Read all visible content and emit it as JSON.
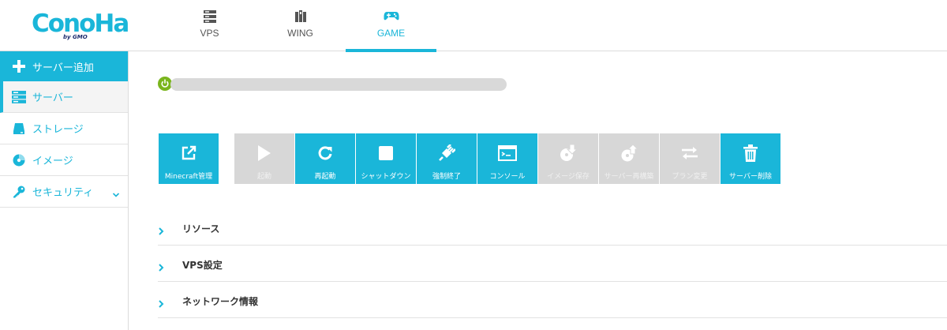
{
  "brand": {
    "logo_text": "ConoHa",
    "logo_sub": "by GMO",
    "accent": "#1ab6d9"
  },
  "nav": {
    "tabs": [
      {
        "label": "VPS",
        "icon": "server-icon"
      },
      {
        "label": "WING",
        "icon": "wing-icon"
      },
      {
        "label": "GAME",
        "icon": "gamepad-icon",
        "active": true
      }
    ]
  },
  "sidebar": {
    "items": [
      {
        "label": "サーバー追加",
        "icon": "plus-icon"
      },
      {
        "label": "サーバー",
        "icon": "server-icon"
      },
      {
        "label": "ストレージ",
        "icon": "storage-icon"
      },
      {
        "label": "イメージ",
        "icon": "disc-icon"
      },
      {
        "label": "セキュリティ",
        "icon": "key-icon"
      }
    ]
  },
  "server": {
    "status": "running",
    "name": ""
  },
  "toolbar": {
    "buttons": [
      {
        "label": "Minecraft管理",
        "icon": "external-link-icon",
        "enabled": true
      },
      {
        "label": "起動",
        "icon": "play-icon",
        "enabled": false
      },
      {
        "label": "再起動",
        "icon": "restart-icon",
        "enabled": true
      },
      {
        "label": "シャットダウン",
        "icon": "stop-icon",
        "enabled": true
      },
      {
        "label": "強制終了",
        "icon": "plug-icon",
        "enabled": true
      },
      {
        "label": "コンソール",
        "icon": "console-icon",
        "enabled": true
      },
      {
        "label": "イメージ保存",
        "icon": "image-save-icon",
        "enabled": false
      },
      {
        "label": "サーバー再構築",
        "icon": "rebuild-icon",
        "enabled": false
      },
      {
        "label": "プラン変更",
        "icon": "plan-change-icon",
        "enabled": false
      },
      {
        "label": "サーバー削除",
        "icon": "trash-icon",
        "enabled": true
      }
    ]
  },
  "sections": [
    {
      "title": "リソース"
    },
    {
      "title": "VPS設定"
    },
    {
      "title": "ネットワーク情報"
    }
  ]
}
